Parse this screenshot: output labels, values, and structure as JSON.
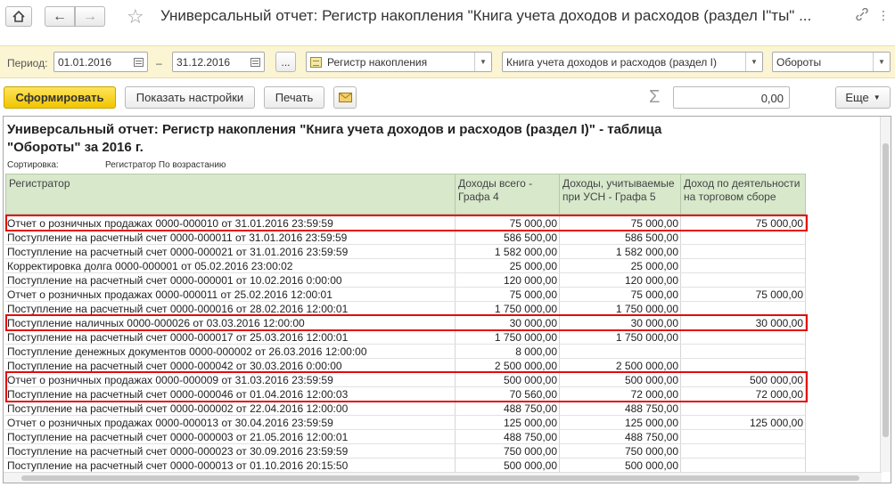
{
  "window": {
    "title": "Универсальный отчет: Регистр накопления \"Книга учета доходов и расходов (раздел I\"ты\" ..."
  },
  "filters": {
    "period_label": "Период:",
    "date_from": "01.01.2016",
    "date_sep": "–",
    "date_to": "31.12.2016",
    "more_label": "...",
    "source_type": "Регистр накопления",
    "source_name": "Книга учета доходов и расходов (раздел I)",
    "table_kind": "Обороты"
  },
  "toolbar": {
    "generate_label": "Сформировать",
    "settings_label": "Показать настройки",
    "print_label": "Печать",
    "sum_value": "0,00",
    "more_label": "Еще"
  },
  "report": {
    "title": "Универсальный отчет: Регистр накопления \"Книга учета доходов и расходов (раздел I)\" - таблица \"Обороты\" за 2016 г.",
    "sort_label": "Сортировка:",
    "sort_value": "Регистратор По возрастанию",
    "columns": [
      "Регистратор",
      "Доходы всего - Графа 4",
      "Доходы, учитываемые при УСН - Графа 5",
      "Доход по деятельности на торговом сборе"
    ],
    "rows": [
      {
        "registrator": "Отчет о розничных продажах 0000-000010 от 31.01.2016 23:59:59",
        "total": "75 000,00",
        "usn": "75 000,00",
        "trade": "75 000,00",
        "highlight": true
      },
      {
        "registrator": "Поступление на расчетный счет 0000-000011 от 31.01.2016 23:59:59",
        "total": "586 500,00",
        "usn": "586 500,00",
        "trade": ""
      },
      {
        "registrator": "Поступление на расчетный счет 0000-000021 от 31.01.2016 23:59:59",
        "total": "1 582 000,00",
        "usn": "1 582 000,00",
        "trade": ""
      },
      {
        "registrator": "Корректировка долга 0000-000001 от 05.02.2016 23:00:02",
        "total": "25 000,00",
        "usn": "25 000,00",
        "trade": ""
      },
      {
        "registrator": "Поступление на расчетный счет 0000-000001 от 10.02.2016 0:00:00",
        "total": "120 000,00",
        "usn": "120 000,00",
        "trade": ""
      },
      {
        "registrator": "Отчет о розничных продажах 0000-000011 от 25.02.2016 12:00:01",
        "total": "75 000,00",
        "usn": "75 000,00",
        "trade": "75 000,00"
      },
      {
        "registrator": "Поступление на расчетный счет 0000-000016 от 28.02.2016 12:00:01",
        "total": "1 750 000,00",
        "usn": "1 750 000,00",
        "trade": ""
      },
      {
        "registrator": "Поступление наличных 0000-000026 от 03.03.2016 12:00:00",
        "total": "30 000,00",
        "usn": "30 000,00",
        "trade": "30 000,00",
        "highlight": true
      },
      {
        "registrator": "Поступление на расчетный счет 0000-000017 от 25.03.2016 12:00:01",
        "total": "1 750 000,00",
        "usn": "1 750 000,00",
        "trade": ""
      },
      {
        "registrator": "Поступление денежных документов 0000-000002 от 26.03.2016 12:00:00",
        "total": "8 000,00",
        "usn": "",
        "trade": ""
      },
      {
        "registrator": "Поступление на расчетный счет 0000-000042 от 30.03.2016 0:00:00",
        "total": "2 500 000,00",
        "usn": "2 500 000,00",
        "trade": ""
      },
      {
        "registrator": "Отчет о розничных продажах 0000-000009 от 31.03.2016 23:59:59",
        "total": "500 000,00",
        "usn": "500 000,00",
        "trade": "500 000,00",
        "highlight": true
      },
      {
        "registrator": "Поступление на расчетный счет 0000-000046 от 01.04.2016 12:00:03",
        "total": "70 560,00",
        "usn": "72 000,00",
        "trade": "72 000,00",
        "highlight": true
      },
      {
        "registrator": "Поступление на расчетный счет 0000-000002 от 22.04.2016 12:00:00",
        "total": "488 750,00",
        "usn": "488 750,00",
        "trade": ""
      },
      {
        "registrator": "Отчет о розничных продажах 0000-000013 от 30.04.2016 23:59:59",
        "total": "125 000,00",
        "usn": "125 000,00",
        "trade": "125 000,00"
      },
      {
        "registrator": "Поступление на расчетный счет 0000-000003 от 21.05.2016 12:00:01",
        "total": "488 750,00",
        "usn": "488 750,00",
        "trade": ""
      },
      {
        "registrator": "Поступление на расчетный счет 0000-000023 от 30.09.2016 23:59:59",
        "total": "750 000,00",
        "usn": "750 000,00",
        "trade": ""
      },
      {
        "registrator": "Поступление на расчетный счет 0000-000013 от 01.10.2016 20:15:50",
        "total": "500 000,00",
        "usn": "500 000,00",
        "trade": ""
      }
    ]
  },
  "colors": {
    "filter_bg": "#fcf5d3",
    "header_bg": "#d7e8cb",
    "primary_button": "#f5cf1f",
    "highlight_border": "#e30b0b"
  }
}
